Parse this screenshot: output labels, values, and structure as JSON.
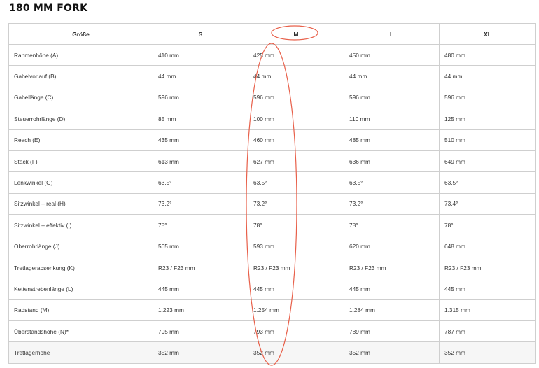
{
  "title": "180 MM FORK",
  "table": {
    "headers": [
      "Größe",
      "S",
      "M",
      "L",
      "XL"
    ],
    "rows": [
      [
        "Rahmenhöhe (A)",
        "410 mm",
        "425 mm",
        "450 mm",
        "480 mm"
      ],
      [
        "Gabelvorlauf (B)",
        "44 mm",
        "44 mm",
        "44 mm",
        "44 mm"
      ],
      [
        "Gabellänge (C)",
        "596 mm",
        "596 mm",
        "596 mm",
        "596 mm"
      ],
      [
        "Steuerrohrlänge (D)",
        "85 mm",
        "100 mm",
        "110 mm",
        "125 mm"
      ],
      [
        "Reach (E)",
        "435 mm",
        "460 mm",
        "485 mm",
        "510 mm"
      ],
      [
        "Stack (F)",
        "613 mm",
        "627 mm",
        "636 mm",
        "649 mm"
      ],
      [
        "Lenkwinkel (G)",
        "63,5°",
        "63,5°",
        "63,5°",
        "63,5°"
      ],
      [
        "Sitzwinkel – real (H)",
        "73,2°",
        "73,2°",
        "73,2°",
        "73,4°"
      ],
      [
        "Sitzwinkel – effektiv (I)",
        "78°",
        "78°",
        "78°",
        "78°"
      ],
      [
        "Oberrohrlänge (J)",
        "565 mm",
        "593 mm",
        "620 mm",
        "648 mm"
      ],
      [
        "Tretlagerabsenkung (K)",
        "R23 / F23 mm",
        "R23 / F23 mm",
        "R23 / F23 mm",
        "R23 / F23 mm"
      ],
      [
        "Kettenstrebenlänge (L)",
        "445 mm",
        "445 mm",
        "445 mm",
        "445 mm"
      ],
      [
        "Radstand (M)",
        "1.223 mm",
        "1.254 mm",
        "1.284 mm",
        "1.315 mm"
      ],
      [
        "Überstandshöhe (N)*",
        "795 mm",
        "793 mm",
        "789 mm",
        "787 mm"
      ],
      [
        "Tretlagerhöhe",
        "352 mm",
        "352 mm",
        "352 mm",
        "352 mm"
      ]
    ]
  },
  "annotation": {
    "color": "#e8604a",
    "highlighted_column": "M"
  }
}
